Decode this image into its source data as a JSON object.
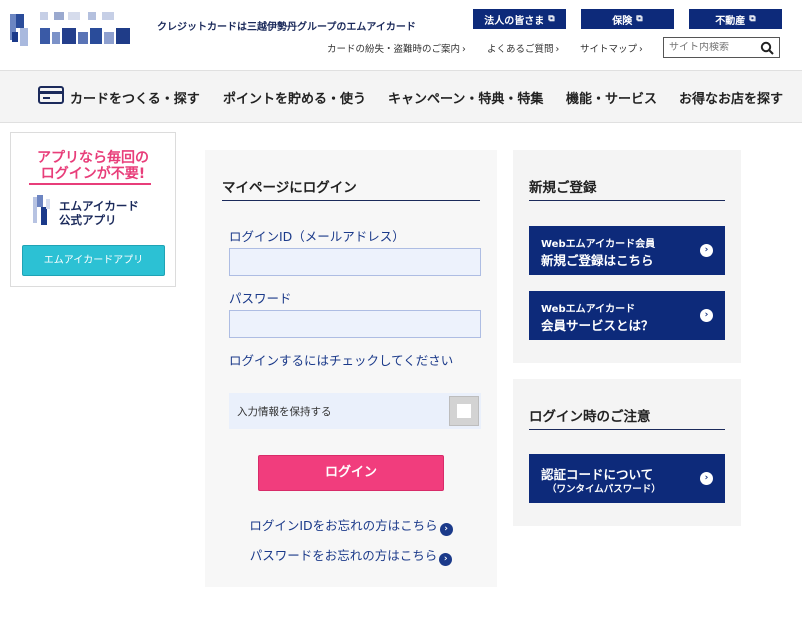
{
  "header": {
    "tagline": "クレジットカードは三越伊勢丹グループのエムアイカード",
    "top_buttons": [
      "法人の皆さま",
      "保険",
      "不動産"
    ],
    "sub_links": [
      "カードの紛失・盗難時のご案内",
      "よくあるご質問",
      "サイトマップ"
    ],
    "search_placeholder": "サイト内検索"
  },
  "nav": {
    "items": [
      "カードをつくる・探す",
      "ポイントを貯める・使う",
      "キャンペーン・特典・特集",
      "機能・サービス",
      "お得なお店を探す"
    ]
  },
  "app_banner": {
    "headline_line1": "アプリなら毎回の",
    "headline_line2": "ログインが不要!",
    "app_name_line1": "エムアイカード",
    "app_name_line2": "公式アプリ",
    "button_label": "エムアイカードアプリ"
  },
  "login": {
    "title": "マイページにログイン",
    "id_label": "ログインID（メールアドレス）",
    "password_label": "パスワード",
    "check_hint": "ログインするにはチェックしてください",
    "keep_label": "入力情報を保持する",
    "login_button": "ログイン",
    "forgot_id": "ログインIDをお忘れの方はこちら",
    "forgot_password": "パスワードをお忘れの方はこちら"
  },
  "register": {
    "title": "新規ご登録",
    "btn1_line1": "Webエムアイカード会員",
    "btn1_line2": "新規ご登録はこちら",
    "btn2_line1": "Webエムアイカード",
    "btn2_line2": "会員サービスとは？"
  },
  "notice": {
    "title": "ログイン時のご注意",
    "btn_line1": "認証コードについて",
    "btn_line2": "（ワンタイムパスワード）"
  },
  "colors": {
    "navy": "#0d2a7a",
    "pink": "#f13d7d",
    "cyan": "#2cc1d4",
    "link_blue": "#1b3a8a"
  }
}
